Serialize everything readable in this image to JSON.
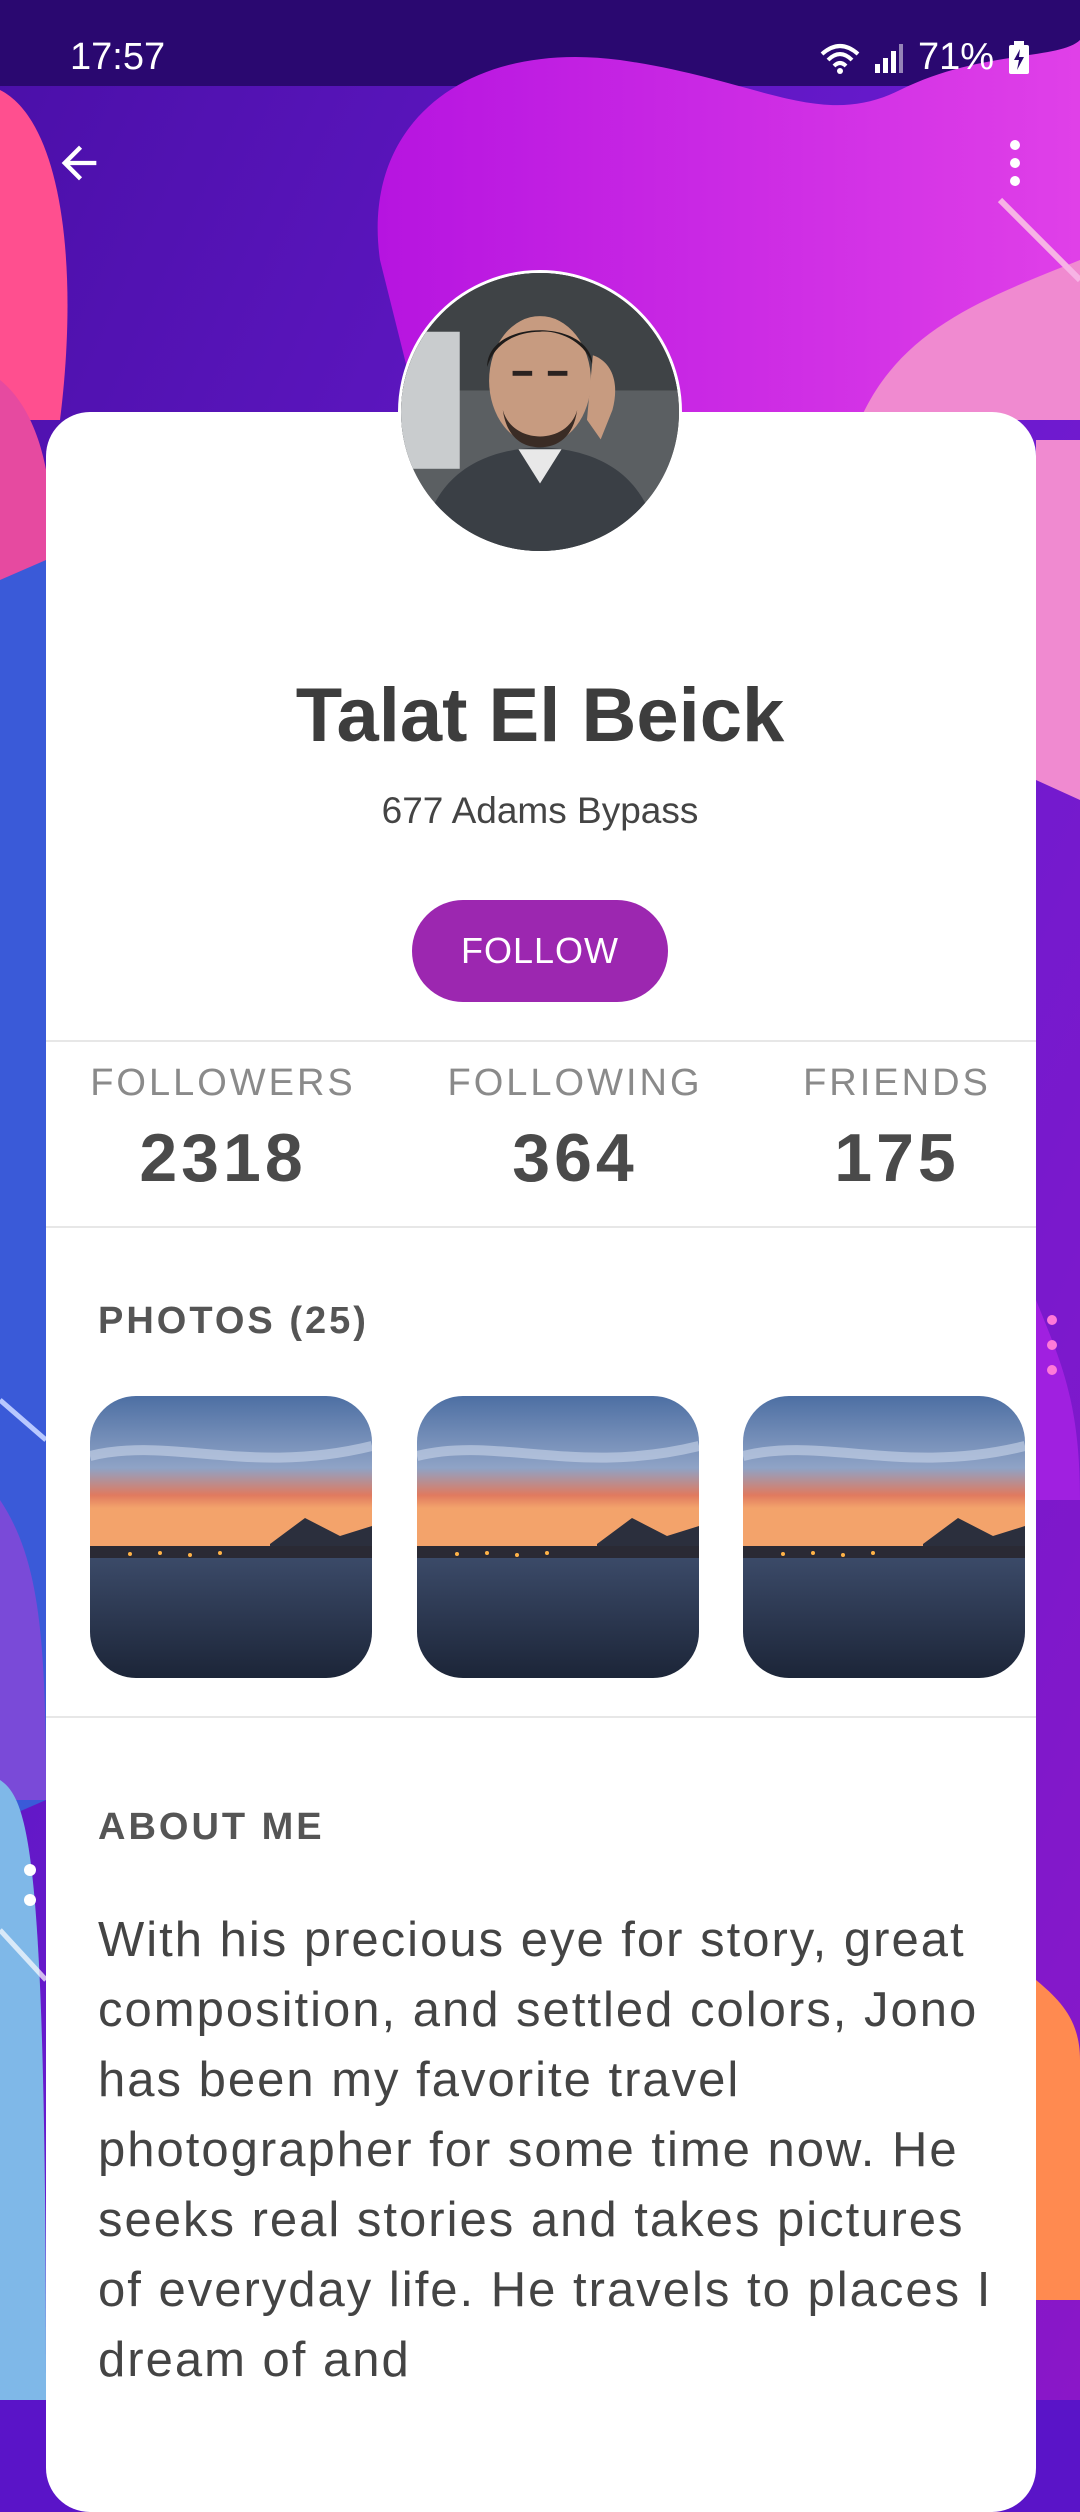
{
  "status_bar": {
    "time": "17:57",
    "battery": "71%"
  },
  "profile": {
    "name": "Talat El Beick",
    "address": "677 Adams Bypass",
    "follow_label": "FOLLOW"
  },
  "stats": [
    {
      "label": "FOLLOWERS",
      "value": "2318"
    },
    {
      "label": "FOLLOWING",
      "value": "364"
    },
    {
      "label": "FRIENDS",
      "value": "175"
    }
  ],
  "photos": {
    "title": "PHOTOS (25)",
    "count_shown": 3
  },
  "about": {
    "title": "ABOUT ME",
    "text": "With his precious eye for story, great composition, and settled colors, Jono has been my favorite travel photographer for some time now. He seeks real stories and takes pictures of everyday life. He travels to places I dream of and"
  },
  "icons": {
    "back": "arrow-back-icon",
    "more": "more-vert-icon"
  },
  "colors": {
    "accent": "#9c27b0",
    "background": "#5a14c8"
  }
}
